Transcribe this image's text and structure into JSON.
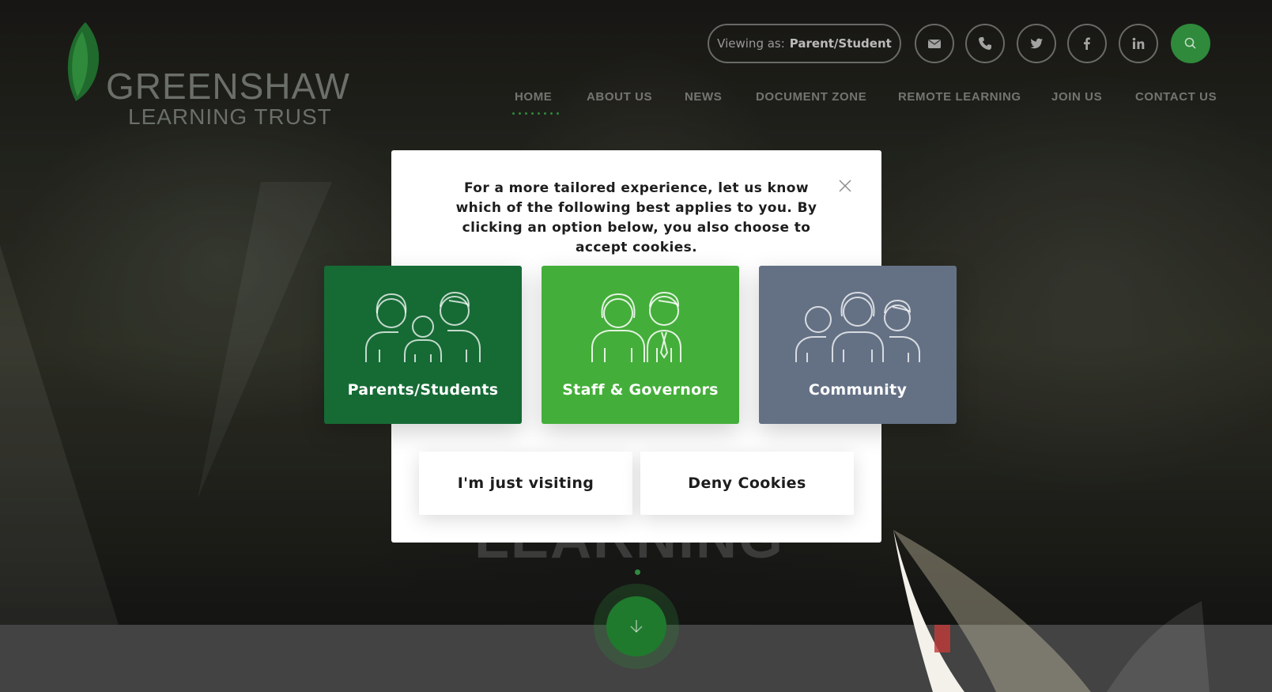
{
  "brand": {
    "name_line1": "GREENSHAW",
    "name_line2": "LEARNING TRUST"
  },
  "header": {
    "viewing_prefix": "Viewing as:",
    "viewing_value": "Parent/Student",
    "icons": [
      "email-icon",
      "phone-icon",
      "twitter-icon",
      "facebook-icon",
      "linkedin-icon",
      "search-icon"
    ]
  },
  "nav": {
    "items": [
      {
        "label": "HOME",
        "active": true
      },
      {
        "label": "ABOUT US"
      },
      {
        "label": "NEWS"
      },
      {
        "label": "DOCUMENT ZONE"
      },
      {
        "label": "REMOTE LEARNING"
      },
      {
        "label": "JOIN US"
      },
      {
        "label": "CONTACT US"
      }
    ]
  },
  "modal": {
    "message": "For a more tailored experience, let us know which of the following best applies to you. By clicking an option below, you also choose to accept cookies.",
    "choices": [
      {
        "label": "Parents/Students",
        "color": "#166b35",
        "icon": "family-icon"
      },
      {
        "label": "Staff & Governors",
        "color": "#44ae3a",
        "icon": "staff-icon"
      },
      {
        "label": "Community",
        "color": "#647185",
        "icon": "group-icon"
      }
    ],
    "actions": {
      "visiting": "I'm just visiting",
      "deny": "Deny Cookies"
    }
  },
  "colors": {
    "accent_green": "#2f8a3c",
    "dark_green": "#166b35",
    "bright_green": "#44ae3a",
    "slate": "#647185"
  }
}
